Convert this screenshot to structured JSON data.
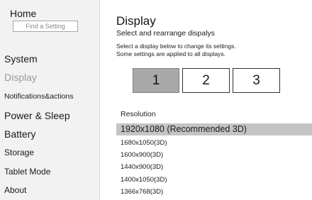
{
  "sidebar": {
    "home_label": "Home",
    "search_placeholder": "Find a Setting",
    "items": [
      {
        "label": "System"
      },
      {
        "label": "Display"
      },
      {
        "label": "Notifications&actions"
      },
      {
        "label": "Power & Sleep"
      },
      {
        "label": "Battery"
      },
      {
        "label": "Storage"
      },
      {
        "label": "Tablet Mode"
      },
      {
        "label": "About"
      }
    ],
    "active_item": "Display"
  },
  "main": {
    "title": "Display",
    "subtitle": "Select and rearrange dispalys",
    "info_line1": "Select a display below to change its settings.",
    "info_line2": "Some settings are applied to all displays.",
    "monitors": [
      {
        "label": "1",
        "selected": true
      },
      {
        "label": "2",
        "selected": false
      },
      {
        "label": "3",
        "selected": false
      }
    ],
    "resolution_label": "Resolution",
    "resolutions": [
      "1920x1080 (Recommended 3D)",
      "1680x1050(3D)",
      "1600x900(3D)",
      "1440x900(3D)",
      "1400x1050(3D)",
      "1366x768(3D)"
    ],
    "selected_resolution": "1920x1080 (Recommended 3D)"
  },
  "colors": {
    "sidebar_bg": "#f2f2f2",
    "selected_monitor_bg": "#a9a9a9",
    "selected_resolution_bg": "#c4c4c4",
    "inactive_text": "#9a9a9a"
  }
}
